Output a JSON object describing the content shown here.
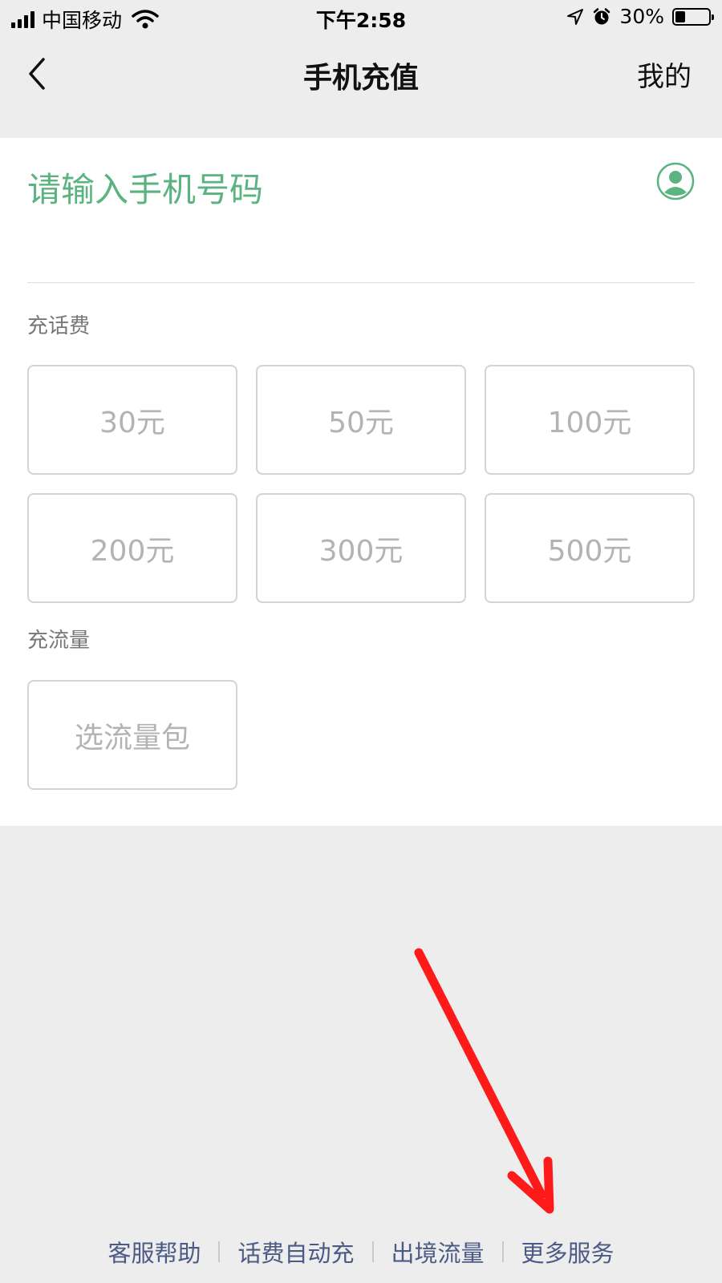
{
  "status_bar": {
    "carrier": "中国移动",
    "time": "下午2:58",
    "battery_percent": "30%",
    "battery_level": 0.3
  },
  "nav": {
    "title": "手机充值",
    "right_label": "我的"
  },
  "phone": {
    "placeholder": "请输入手机号码"
  },
  "topup": {
    "title": "充话费",
    "amounts": [
      "30元",
      "50元",
      "100元",
      "200元",
      "300元",
      "500元"
    ]
  },
  "data_plan": {
    "title": "充流量",
    "button": "选流量包"
  },
  "footer": {
    "links": [
      "客服帮助",
      "话费自动充",
      "出境流量",
      "更多服务"
    ]
  },
  "colors": {
    "accent": "#5bb37f",
    "link": "#4c5a86",
    "annotation": "#ff1a1a"
  }
}
